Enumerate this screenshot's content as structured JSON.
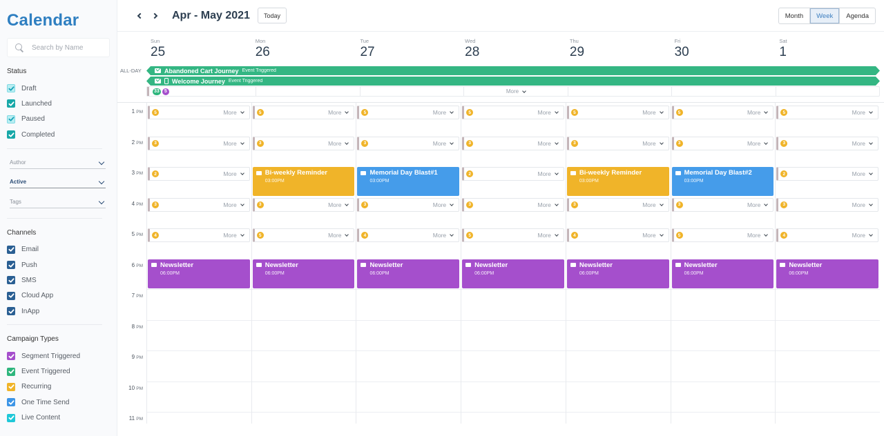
{
  "sidebar": {
    "title": "Calendar",
    "search": {
      "placeholder": "Search by Name",
      "value": ""
    },
    "status": {
      "label": "Status",
      "items": [
        {
          "label": "Draft",
          "checked": true,
          "color": "#b9eef2",
          "check_color": "#17a2b8",
          "light": true
        },
        {
          "label": "Launched",
          "checked": true,
          "color": "#18a8a8",
          "check_color": "#ffffff",
          "light": false
        },
        {
          "label": "Paused",
          "checked": true,
          "color": "#b9eef2",
          "check_color": "#17a2b8",
          "light": true
        },
        {
          "label": "Completed",
          "checked": true,
          "color": "#18a8a8",
          "check_color": "#ffffff",
          "light": false
        }
      ]
    },
    "filters": [
      {
        "label": "Author",
        "active": false
      },
      {
        "label": "Active",
        "active": true
      },
      {
        "label": "Tags",
        "active": false
      }
    ],
    "channels": {
      "label": "Channels",
      "items": [
        {
          "label": "Email",
          "checked": true,
          "color": "#2a5f93"
        },
        {
          "label": "Push",
          "checked": true,
          "color": "#2a5f93"
        },
        {
          "label": "SMS",
          "checked": true,
          "color": "#2a5f93"
        },
        {
          "label": "Cloud App",
          "checked": true,
          "color": "#2a5f93"
        },
        {
          "label": "InApp",
          "checked": true,
          "color": "#2a5f93"
        }
      ]
    },
    "campaign_types": {
      "label": "Campaign Types",
      "items": [
        {
          "label": "Segment Triggered",
          "checked": true,
          "color": "#a54fcc"
        },
        {
          "label": "Event Triggered",
          "checked": true,
          "color": "#2eb67d"
        },
        {
          "label": "Recurring",
          "checked": true,
          "color": "#f0b429"
        },
        {
          "label": "One Time Send",
          "checked": true,
          "color": "#3d95e6"
        },
        {
          "label": "Live Content",
          "checked": true,
          "color": "#1fc8d8"
        }
      ]
    }
  },
  "toolbar": {
    "prev_label": "previous",
    "next_label": "next",
    "range_title": "Apr - May 2021",
    "today_label": "Today",
    "views": [
      {
        "label": "Month",
        "active": false
      },
      {
        "label": "Week",
        "active": true
      },
      {
        "label": "Agenda",
        "active": false
      }
    ]
  },
  "days": [
    {
      "dow": "Sun",
      "date": "25"
    },
    {
      "dow": "Mon",
      "date": "26"
    },
    {
      "dow": "Tue",
      "date": "27"
    },
    {
      "dow": "Wed",
      "date": "28"
    },
    {
      "dow": "Thu",
      "date": "29"
    },
    {
      "dow": "Fri",
      "date": "30"
    },
    {
      "dow": "Sat",
      "date": "1"
    }
  ],
  "all_day": {
    "label": "ALL-DAY",
    "events": [
      {
        "title": "Abandoned Cart Journey",
        "type": "Event Triggered",
        "icons": [
          "mail"
        ]
      },
      {
        "title": "Welcome Journey",
        "type": "Event Triggered",
        "icons": [
          "mail",
          "phone"
        ]
      }
    ],
    "badges": [
      {
        "count": "33",
        "color": "#2eb67d"
      },
      {
        "count": "5",
        "color": "#a54fcc"
      }
    ],
    "more_label": "More"
  },
  "colors": {
    "event_triggered": "#34b683",
    "segment_triggered": "#a54fcc",
    "recurring": "#f0b429",
    "one_time_send": "#459cea",
    "badge": "#f0b429"
  },
  "time_labels": [
    {
      "hour": "1",
      "ampm": "PM"
    },
    {
      "hour": "2",
      "ampm": "PM"
    },
    {
      "hour": "3",
      "ampm": "PM"
    },
    {
      "hour": "4",
      "ampm": "PM"
    },
    {
      "hour": "5",
      "ampm": "PM"
    },
    {
      "hour": "6",
      "ampm": "PM"
    },
    {
      "hour": "7",
      "ampm": "PM"
    },
    {
      "hour": "8",
      "ampm": "PM"
    },
    {
      "hour": "9",
      "ampm": "PM"
    },
    {
      "hour": "10",
      "ampm": "PM"
    },
    {
      "hour": "11",
      "ampm": "PM"
    }
  ],
  "more_label": "More",
  "slots": [
    {
      "time": "1 PM",
      "cells": [
        {
          "more": "5"
        },
        {
          "more": "5"
        },
        {
          "more": "5"
        },
        {
          "more": "5"
        },
        {
          "more": "5"
        },
        {
          "more": "5"
        },
        {
          "more": "5"
        }
      ]
    },
    {
      "time": "2 PM",
      "cells": [
        {
          "more": "3"
        },
        {
          "more": "3"
        },
        {
          "more": "3"
        },
        {
          "more": "3"
        },
        {
          "more": "3"
        },
        {
          "more": "3"
        },
        {
          "more": "3"
        }
      ]
    },
    {
      "time": "3 PM",
      "cells": [
        {
          "more": "2"
        },
        {
          "event": {
            "title": "Bi-weekly Reminder",
            "time": "03:00PM",
            "kind": "recurring"
          }
        },
        {
          "event": {
            "title": "Memorial Day Blast#1",
            "time": "03:00PM",
            "kind": "one_time_send"
          }
        },
        {
          "more": "2"
        },
        {
          "event": {
            "title": "Bi-weekly Reminder",
            "time": "03:00PM",
            "kind": "recurring"
          }
        },
        {
          "event": {
            "title": "Memorial Day Blast#2",
            "time": "03:00PM",
            "kind": "one_time_send"
          }
        },
        {
          "more": "2"
        }
      ]
    },
    {
      "time": "4 PM",
      "cells": [
        {
          "more": "3"
        },
        {
          "more": "3"
        },
        {
          "more": "3"
        },
        {
          "more": "3"
        },
        {
          "more": "3"
        },
        {
          "more": "3"
        },
        {
          "more": "3"
        }
      ]
    },
    {
      "time": "5 PM",
      "cells": [
        {
          "more": "4"
        },
        {
          "more": "5"
        },
        {
          "more": "4"
        },
        {
          "more": "5"
        },
        {
          "more": "4"
        },
        {
          "more": "5"
        },
        {
          "more": "4"
        }
      ]
    },
    {
      "time": "6 PM",
      "cells": [
        {
          "event": {
            "title": "Newsletter",
            "time": "06:00PM",
            "kind": "segment_triggered"
          }
        },
        {
          "event": {
            "title": "Newsletter",
            "time": "06:00PM",
            "kind": "segment_triggered"
          }
        },
        {
          "event": {
            "title": "Newsletter",
            "time": "06:00PM",
            "kind": "segment_triggered"
          }
        },
        {
          "event": {
            "title": "Newsletter",
            "time": "06:00PM",
            "kind": "segment_triggered"
          }
        },
        {
          "event": {
            "title": "Newsletter",
            "time": "06:00PM",
            "kind": "segment_triggered"
          }
        },
        {
          "event": {
            "title": "Newsletter",
            "time": "06:00PM",
            "kind": "segment_triggered"
          }
        },
        {
          "event": {
            "title": "Newsletter",
            "time": "06:00PM",
            "kind": "segment_triggered"
          }
        }
      ]
    }
  ]
}
